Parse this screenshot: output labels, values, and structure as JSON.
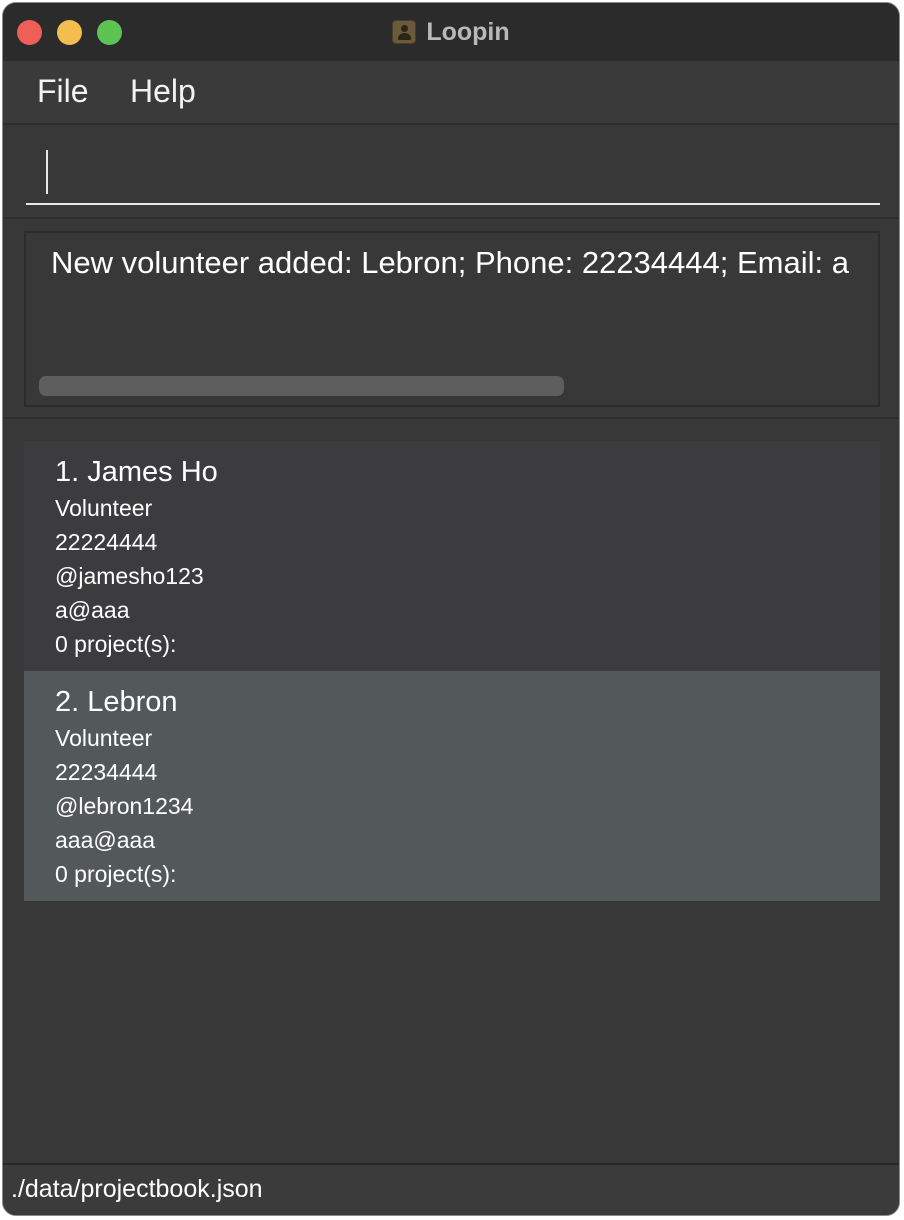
{
  "window": {
    "title": "Loopin"
  },
  "menu": {
    "file_label": "File",
    "help_label": "Help"
  },
  "command": {
    "value": "",
    "placeholder": ""
  },
  "result": {
    "text": "New volunteer added: Lebron; Phone: 22234444; Email: a"
  },
  "persons": [
    {
      "name": "1. James Ho",
      "role": "Volunteer",
      "phone": "22224444",
      "telegram": "@jamesho123",
      "email": "a@aaa",
      "projects": "0 project(s):"
    },
    {
      "name": "2. Lebron",
      "role": "Volunteer",
      "phone": "22234444",
      "telegram": "@lebron1234",
      "email": "aaa@aaa",
      "projects": "0 project(s):"
    }
  ],
  "status": {
    "path": "./data/projectbook.json"
  },
  "colors": {
    "close": "#ee5f57",
    "minimize": "#f4bd4f",
    "maximize": "#5dc454",
    "selected_card": "#53585b"
  }
}
